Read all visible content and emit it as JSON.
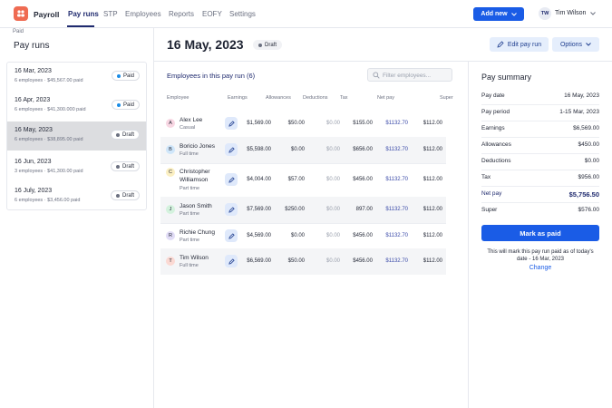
{
  "app": {
    "name": "Payroll"
  },
  "nav": {
    "items": [
      {
        "label": "Pay runs",
        "active": true
      },
      {
        "label": "STP"
      },
      {
        "label": "Employees"
      },
      {
        "label": "Reports"
      },
      {
        "label": "EOFY"
      },
      {
        "label": "Settings"
      }
    ],
    "add_new": "Add new",
    "user_initials": "TW",
    "user_name": "Tim Wilson"
  },
  "sidebar": {
    "breadcrumb": "Paid",
    "title": "Pay runs",
    "runs": [
      {
        "date": "16 Mar, 2023",
        "meta": "6 employees · $45,567.00 paid",
        "status": "Paid"
      },
      {
        "date": "16 Apr, 2023",
        "meta": "6 employees · $41,300.000 paid",
        "status": "Paid"
      },
      {
        "date": "16 May, 2023",
        "meta": "6 employees · $38,895.00 paid",
        "status": "Draft",
        "active": true
      },
      {
        "date": "16 Jun, 2023",
        "meta": "3 employees · $41,300.00 paid",
        "status": "Draft"
      },
      {
        "date": "16 July, 2023",
        "meta": "6 employees · $3,456.00 paid",
        "status": "Draft"
      }
    ]
  },
  "main": {
    "title": "16 May, 2023",
    "status": "Draft",
    "edit_label": "Edit pay run",
    "options_label": "Options",
    "employees_heading": "Employees in this pay run (6)",
    "filter_placeholder": "Filter employees...",
    "columns": [
      "Employee",
      "Earnings",
      "Allowances",
      "Deductions",
      "Tax",
      "Net pay",
      "Super"
    ],
    "employees": [
      {
        "initial": "A",
        "name": "Alex Lee",
        "type": "Casual",
        "earnings": "$1,569.00",
        "allowances": "$50.00",
        "deductions": "$0.00",
        "tax": "$155.00",
        "net": "$1132.70",
        "super": "$112.00",
        "color": "#f8d7e3"
      },
      {
        "initial": "B",
        "name": "Boricio Jones",
        "type": "Full time",
        "earnings": "$5,598.00",
        "allowances": "$0.00",
        "deductions": "$0.00",
        "tax": "$656.00",
        "net": "$1132.70",
        "super": "$112.00",
        "color": "#cfe6fa"
      },
      {
        "initial": "C",
        "name": "Christopher Williamson",
        "type": "Part time",
        "earnings": "$4,004.00",
        "allowances": "$57.00",
        "deductions": "$0.00",
        "tax": "$456.00",
        "net": "$1132.70",
        "super": "$112.00",
        "color": "#fbefc2"
      },
      {
        "initial": "J",
        "name": "Jason Smith",
        "type": "Part time",
        "earnings": "$7,569.00",
        "allowances": "$250.00",
        "deductions": "$0.00",
        "tax": "897.00",
        "net": "$1132.70",
        "super": "$112.00",
        "color": "#d4f2de"
      },
      {
        "initial": "R",
        "name": "Richie Chung",
        "type": "Part time",
        "earnings": "$4,569.00",
        "allowances": "$0.00",
        "deductions": "$0.00",
        "tax": "$456.00",
        "net": "$1132.70",
        "super": "$112.00",
        "color": "#e1dcf6"
      },
      {
        "initial": "T",
        "name": "Tim Wilson",
        "type": "Full time",
        "earnings": "$6,569.00",
        "allowances": "$50.00",
        "deductions": "$0.00",
        "tax": "$456.00",
        "net": "$1132.70",
        "super": "$112.00",
        "color": "#fbd9d3"
      }
    ]
  },
  "summary": {
    "title": "Pay summary",
    "rows": [
      {
        "label": "Pay date",
        "value": "16 May, 2023"
      },
      {
        "label": "Pay period",
        "value": "1-15 Mar, 2023"
      },
      {
        "label": "Earnings",
        "value": "$6,569.00"
      },
      {
        "label": "Allowances",
        "value": "$450.00"
      },
      {
        "label": "Deductions",
        "value": "$0.00"
      },
      {
        "label": "Tax",
        "value": "$956.00"
      },
      {
        "label": "Net pay",
        "value": "$5,756.50"
      },
      {
        "label": "Super",
        "value": "$576.00"
      }
    ],
    "mark_paid": "Mark as paid",
    "note": "This will mark this pay run paid as of today's date - 16 Mar, 2023",
    "change": "Change"
  },
  "colors": {
    "primary": "#1a5ce6",
    "navy": "#1f2a6e",
    "logo": "#ef6b52"
  }
}
